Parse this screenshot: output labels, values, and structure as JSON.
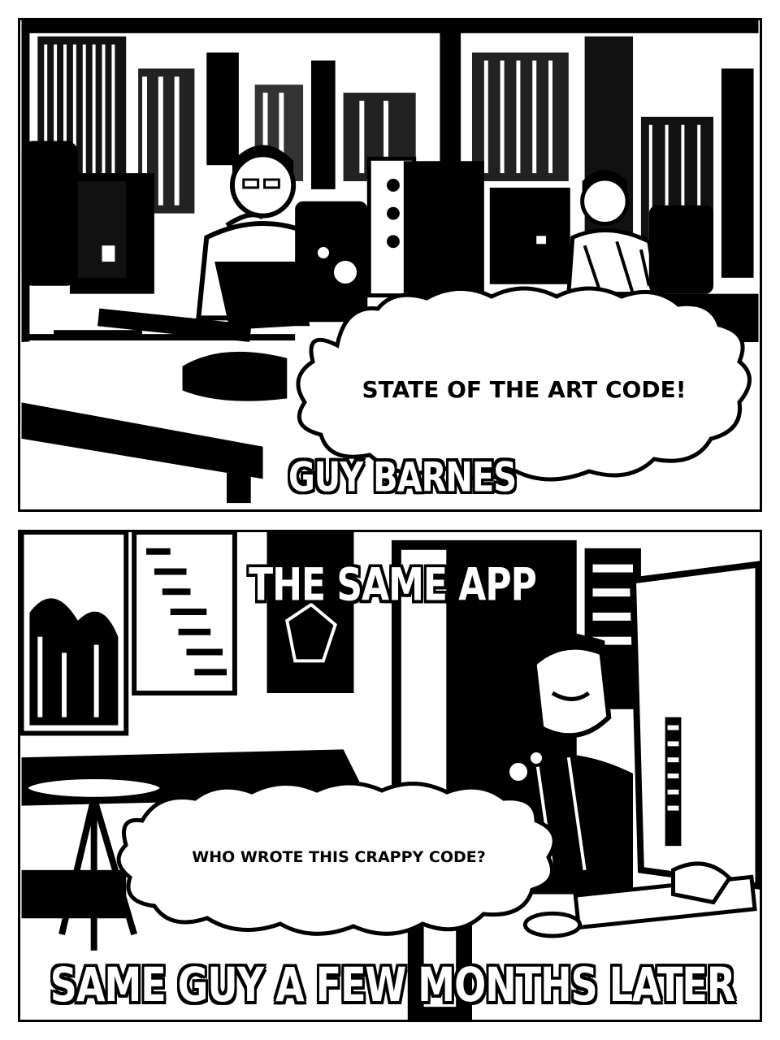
{
  "panel1": {
    "thought_text": "STATE OF THE ART CODE!",
    "caption": "GUY BARNES"
  },
  "panel2": {
    "caption_top": "THE SAME APP",
    "thought_text": "WHO WROTE THIS CRAPPY CODE?",
    "caption_bottom": "SAME GUY A FEW MONTHS LATER"
  },
  "colors": {
    "ink": "#000000",
    "paper": "#ffffff"
  }
}
